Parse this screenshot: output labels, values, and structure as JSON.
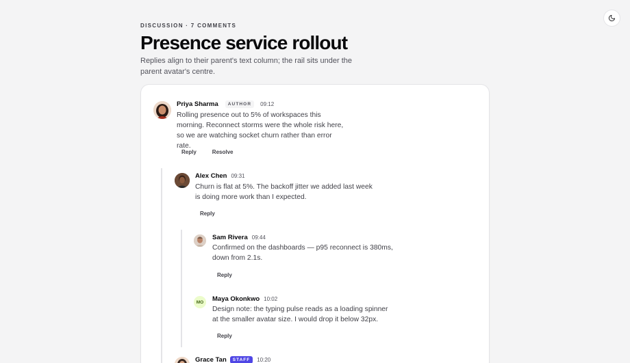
{
  "header": {
    "eyebrow": "DISCUSSION · 7 COMMENTS",
    "title": "Presence service rollout",
    "subtitle": "Replies align to their parent's text column; the rail sits under the parent avatar's centre."
  },
  "theme_toggle": {
    "icon": "moon-icon"
  },
  "colors": {
    "page_bg": "#f4f4f5",
    "card_bg": "#ffffff",
    "staff_badge": "#4f46e5",
    "rail": "#e4e4e7"
  },
  "comments": [
    {
      "author": "Priya Sharma",
      "badge": "AUTHOR",
      "time": "09:12",
      "text": "Rolling presence out to 5% of workspaces this morning. Reconnect storms were the whole risk here, so we are watching socket churn rather than error rate.",
      "actions": [
        "Reply",
        "Resolve"
      ]
    },
    {
      "author": "Alex Chen",
      "time": "09:31",
      "text": "Churn is flat at 5%. The backoff jitter we added last week is doing more work than I expected.",
      "actions": [
        "Reply"
      ]
    },
    {
      "author": "Sam Rivera",
      "time": "09:44",
      "text": "Confirmed on the dashboards — p95 reconnect is 380ms, down from 2.1s.",
      "actions": [
        "Reply"
      ]
    },
    {
      "author": "Maya Okonkwo",
      "initials": "MO",
      "time": "10:02",
      "text": "Design note: the typing pulse reads as a loading spinner at the smaller avatar size. I would drop it below 32px.",
      "actions": [
        "Reply"
      ]
    },
    {
      "author": "Grace Tan",
      "badge": "STAFF",
      "time": "10:20"
    }
  ]
}
